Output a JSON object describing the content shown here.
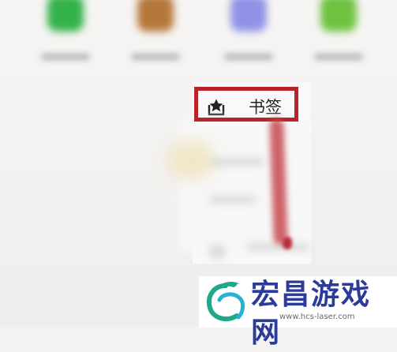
{
  "menu": {
    "bookmark_label": "书签",
    "bookmark_icon": "bookmark-star-icon"
  },
  "apps": {
    "icon_colors": [
      "#34b24a",
      "#b5773a",
      "#8f92e6",
      "#6fc240"
    ]
  },
  "watermark": {
    "title": "宏昌游戏网",
    "url": "www.hcs-laser.com"
  },
  "colors": {
    "highlight": "#b8232a",
    "watermark_title": "#2c3b98"
  }
}
